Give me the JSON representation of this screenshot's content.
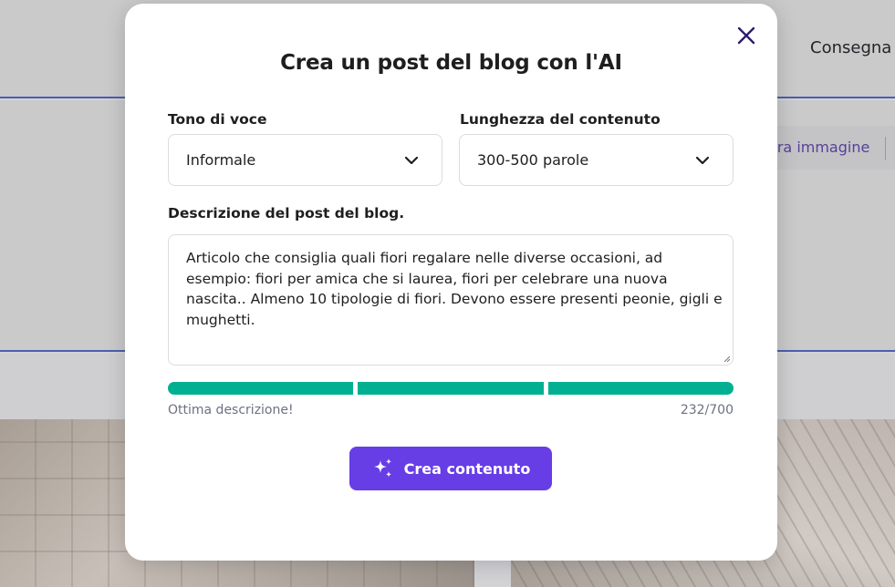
{
  "background": {
    "header_link": "Consegna",
    "toolbar_link": "era immagine"
  },
  "modal": {
    "title": "Crea un post del blog con l'AI",
    "close_icon": "close-icon",
    "tone": {
      "label": "Tono di voce",
      "value": "Informale",
      "icon": "chevron-down-icon"
    },
    "length": {
      "label": "Lunghezza del contenuto",
      "value": "300-500 parole",
      "icon": "chevron-down-icon"
    },
    "description": {
      "label": "Descrizione del post del blog.",
      "value": "Articolo che consiglia quali fiori regalare nelle diverse occasioni, ad esempio: fiori per amica che si laurea, fiori per celebrare una nuova nascita.. Almeno 10 tipologie di fiori. Devono essere presenti peonie, gigli e mughetti."
    },
    "quality": {
      "segments_filled": 3,
      "segments_total": 3,
      "hint": "Ottima descrizione!",
      "counter": "232/700"
    },
    "create_button": {
      "label": "Crea contenuto",
      "icon": "sparkle-icon"
    }
  },
  "colors": {
    "accent": "#673de6",
    "progress": "#00b090",
    "text": "#1d1e20",
    "muted": "#6d7081"
  }
}
